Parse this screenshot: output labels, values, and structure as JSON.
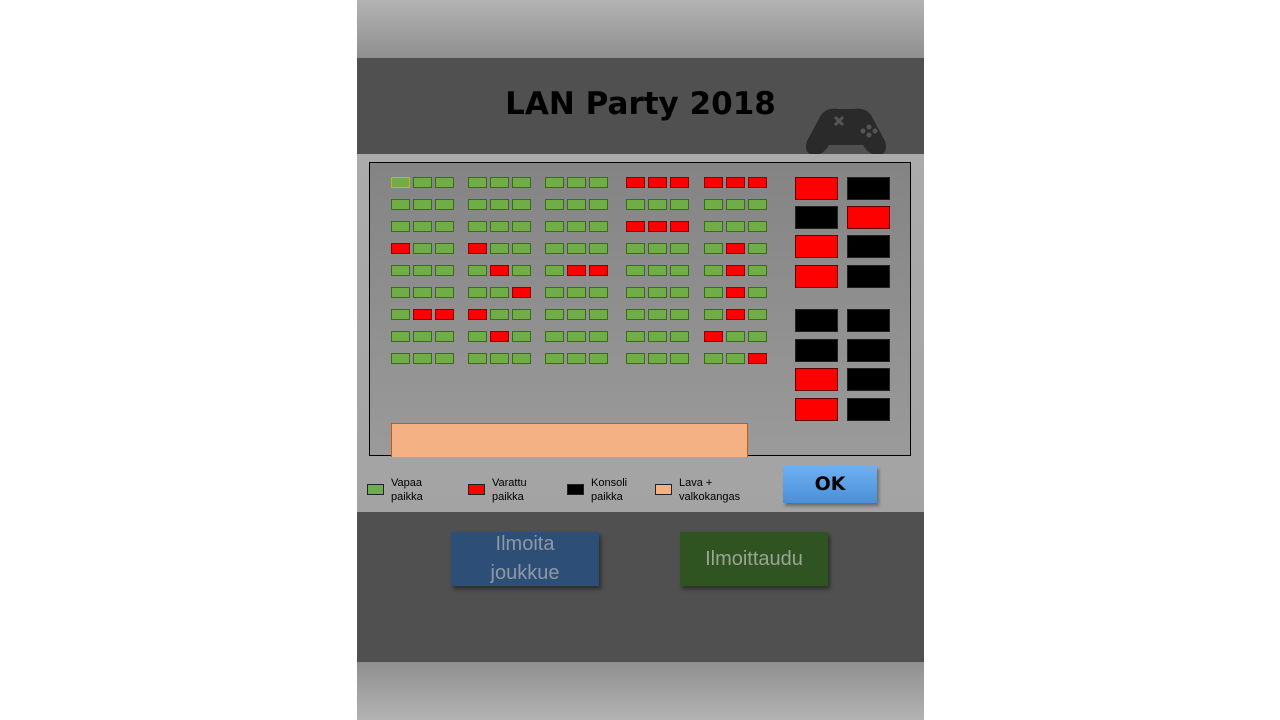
{
  "header": {
    "title": "LAN Party 2018",
    "icon": "gamepad-icon"
  },
  "legend": [
    {
      "label": "Vapaa\npaikka",
      "color": "#70ad47"
    },
    {
      "label": "Varattu\npaikka",
      "color": "#ff0000"
    },
    {
      "label": "Konsoli\npaikka",
      "color": "#000000"
    },
    {
      "label": "Lava +\nvalkokangas",
      "color": "#f4b183"
    }
  ],
  "ok_label": "OK",
  "buttons": {
    "team": "Ilmoita\njoukkue",
    "signup": "Ilmoittaudu"
  },
  "seating": {
    "status_key": "f = free seat, t = taken seat",
    "selected_seat": "row 1, block 1, seat 1",
    "blocks": [
      [
        "fff",
        "fff",
        "fff",
        "tff",
        "fff",
        "fff",
        "ftt",
        "fff",
        "fff"
      ],
      [
        "fff",
        "fff",
        "fff",
        "tff",
        "ftf",
        "fft",
        "tff",
        "ftf",
        "fff"
      ],
      [
        "fff",
        "fff",
        "fff",
        "fff",
        "ftt",
        "fff",
        "fff",
        "fff",
        "fff"
      ],
      [
        "ttt",
        "fff",
        "ttt",
        "fff",
        "fff",
        "fff",
        "fff",
        "fff",
        "fff"
      ],
      [
        "ttt",
        "fff",
        "fff",
        "ftf",
        "ftf",
        "ftf",
        "ftf",
        "tff",
        "fft"
      ]
    ],
    "console_rows": [
      [
        "taken",
        "console"
      ],
      [
        "console",
        "taken"
      ],
      [
        "taken",
        "console"
      ],
      [
        "taken",
        "console"
      ],
      [
        "console",
        "console"
      ],
      [
        "console",
        "console"
      ],
      [
        "taken",
        "console"
      ],
      [
        "taken",
        "console"
      ]
    ]
  }
}
